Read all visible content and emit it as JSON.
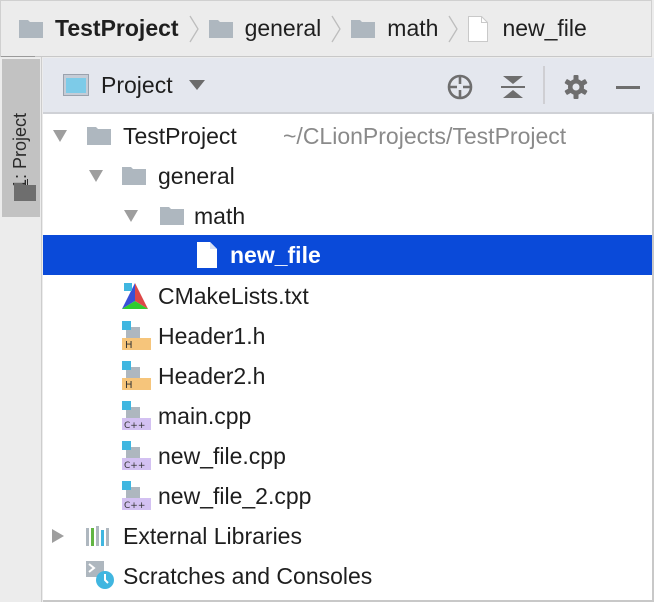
{
  "breadcrumb": {
    "items": [
      {
        "label": "TestProject",
        "icon": "folder-icon",
        "bold": true
      },
      {
        "label": "general",
        "icon": "folder-icon",
        "bold": false
      },
      {
        "label": "math",
        "icon": "folder-icon",
        "bold": false
      },
      {
        "label": "new_file",
        "icon": "file-icon",
        "bold": false
      }
    ]
  },
  "toolstrip": {
    "tab_mnemonic": "1",
    "tab_label": ": Project"
  },
  "panel": {
    "view_label": "Project",
    "buttons": [
      {
        "name": "locate-icon",
        "tooltip": "Scroll from Source"
      },
      {
        "name": "collapse-all-icon",
        "tooltip": "Collapse All"
      },
      {
        "name": "gear-icon",
        "tooltip": "Settings"
      },
      {
        "name": "minimize-icon",
        "tooltip": "Hide"
      }
    ]
  },
  "tree": {
    "rows": [
      {
        "label": "TestProject",
        "path": "~/CLionProjects/TestProject",
        "icon": "folder-icon",
        "expanded": true,
        "depth": 0
      },
      {
        "label": "general",
        "icon": "folder-icon",
        "expanded": true,
        "depth": 1
      },
      {
        "label": "math",
        "icon": "folder-icon",
        "expanded": true,
        "depth": 2
      },
      {
        "label": "new_file",
        "icon": "file-icon",
        "selected": true,
        "depth": 3
      },
      {
        "label": "CMakeLists.txt",
        "icon": "cmake-icon",
        "depth": 1
      },
      {
        "label": "Header1.h",
        "icon": "header-file-icon",
        "badge": "H",
        "depth": 1
      },
      {
        "label": "Header2.h",
        "icon": "header-file-icon",
        "badge": "H",
        "depth": 1
      },
      {
        "label": "main.cpp",
        "icon": "cpp-file-icon",
        "badge": "C++",
        "depth": 1
      },
      {
        "label": "new_file.cpp",
        "icon": "cpp-file-icon",
        "badge": "C++",
        "depth": 1
      },
      {
        "label": "new_file_2.cpp",
        "icon": "cpp-file-icon",
        "badge": "C++",
        "depth": 1
      },
      {
        "label": "External Libraries",
        "icon": "library-icon",
        "expanded": false,
        "depth": 0
      },
      {
        "label": "Scratches and Consoles",
        "icon": "scratches-icon",
        "depth": 0
      }
    ]
  },
  "colors": {
    "selection": "#0a4ad9",
    "folder": "#aeb7bf",
    "header_badge": "#f6c57b",
    "cpp_badge": "#d3c1f2",
    "accent_blue": "#40b6e0"
  }
}
